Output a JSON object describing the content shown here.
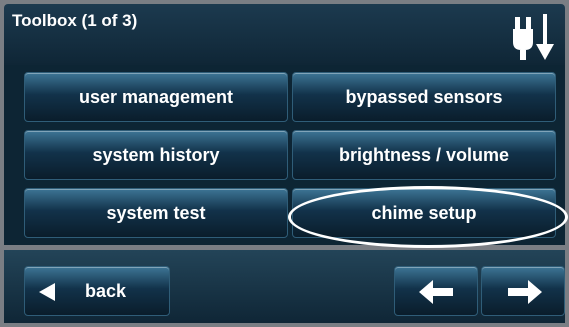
{
  "header": {
    "title": "Toolbox (1 of 3)",
    "status_icon": "ac-power-icon"
  },
  "tiles": [
    {
      "label": "user management"
    },
    {
      "label": "bypassed sensors"
    },
    {
      "label": "system history"
    },
    {
      "label": "brightness / volume"
    },
    {
      "label": "system test"
    },
    {
      "label": "chime setup"
    }
  ],
  "footer": {
    "back_label": "back",
    "back_icon": "triangle-left-icon",
    "prev_icon": "arrow-left-icon",
    "next_icon": "arrow-right-icon"
  },
  "colors": {
    "header_bg": "#1c3a4f",
    "tile_top": "#3d7595",
    "tile_bottom": "#0a1d2b",
    "frame": "#7a7e84",
    "highlight": "#ffffff"
  }
}
